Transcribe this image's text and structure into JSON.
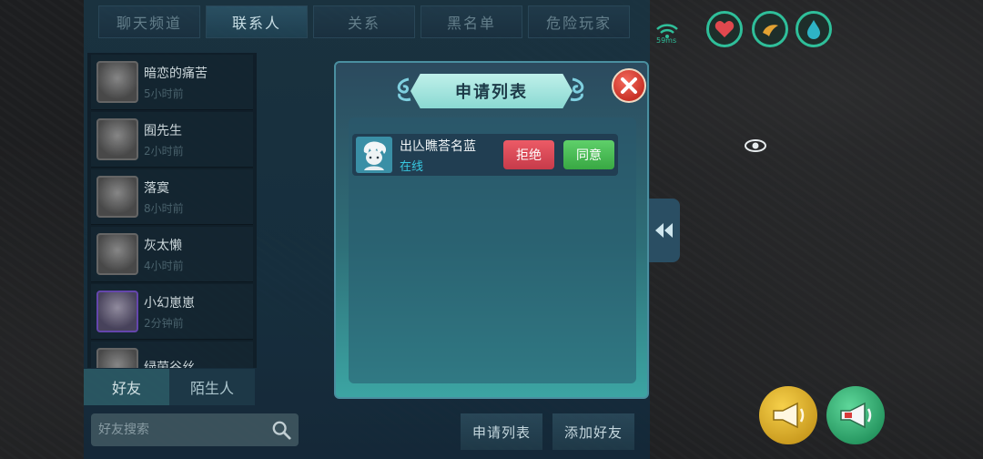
{
  "tabs": [
    {
      "label": "聊天频道",
      "active": false
    },
    {
      "label": "联系人",
      "active": true
    },
    {
      "label": "关系",
      "active": false
    },
    {
      "label": "黑名单",
      "active": false
    },
    {
      "label": "危险玩家",
      "active": false
    }
  ],
  "contacts": [
    {
      "name": "暗恋的痛苦",
      "time": "5小时前"
    },
    {
      "name": "囿先生",
      "time": "2小时前"
    },
    {
      "name": "落寞",
      "time": "8小时前"
    },
    {
      "name": "灰太懒",
      "time": "4小时前"
    },
    {
      "name": "小幻崽崽",
      "time": "2分钟前"
    },
    {
      "name": "绿茵谷丝",
      "time": ""
    }
  ],
  "list_tabs": {
    "friends": "好友",
    "strangers": "陌生人"
  },
  "search": {
    "placeholder": "好友搜索"
  },
  "bottom_buttons": {
    "request_list": "申请列表",
    "add_friend": "添加好友"
  },
  "modal": {
    "title": "申请列表",
    "requests": [
      {
        "name": "出亾瞧荅名蓝",
        "status": "在线",
        "reject_label": "拒绝",
        "accept_label": "同意"
      }
    ]
  },
  "hud": {
    "signal_text": "59ms"
  },
  "colors": {
    "accent": "#2fbf9a",
    "reject": "#d94a56",
    "accept": "#4cbf57",
    "online": "#38c8e0"
  }
}
